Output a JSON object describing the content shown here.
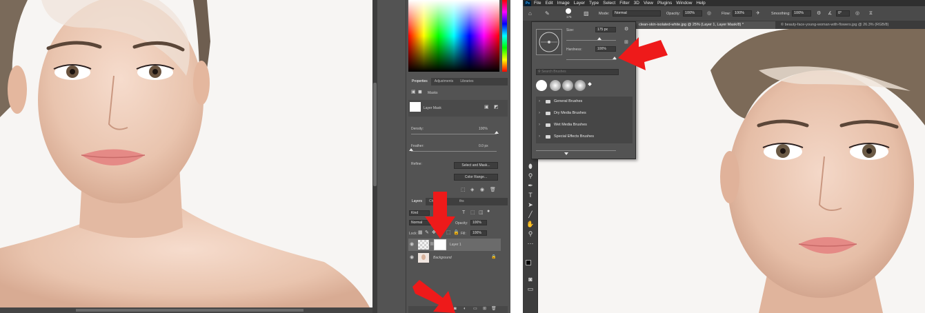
{
  "colors": {
    "arrow": "#f01a1a",
    "panel_bg": "#535353",
    "dark_bg": "#2f2f2f",
    "canvas_bg": "#ffffff"
  },
  "left": {
    "properties_tabs": [
      "Properties",
      "Adjustments",
      "Libraries"
    ],
    "masks_label": "Masks",
    "layer_mask_label": "Layer Mask",
    "density_label": "Density:",
    "density_value": "100%",
    "feather_label": "Feather:",
    "feather_value": "0.0 px",
    "refine_label": "Refine:",
    "select_mask_button": "Select and Mask...",
    "color_range_button": "Color Range...",
    "layers_tabs": [
      "Layers",
      "Chan",
      "ths"
    ],
    "kind_label": "Kind",
    "blend_mode": "Normal",
    "opacity_label": "Opacity:",
    "opacity_value": "100%",
    "lock_label": "Lock:",
    "fill_label": "Fill:",
    "fill_value": "100%",
    "layers": [
      {
        "name": "Layer 1",
        "selected": true
      },
      {
        "name": "Background",
        "selected": false
      }
    ],
    "footer_fx": "fx"
  },
  "right": {
    "menu": [
      "File",
      "Edit",
      "Image",
      "Layer",
      "Type",
      "Select",
      "Filter",
      "3D",
      "View",
      "Plugins",
      "Window",
      "Help"
    ],
    "ps_logo": "Ps",
    "options": {
      "brush_size": "175",
      "mode_label": "Mode:",
      "mode_value": "Normal",
      "opacity_label": "Opacity:",
      "opacity_value": "100%",
      "flow_label": "Flow:",
      "flow_value": "100%",
      "smoothing_label": "Smoothing:",
      "smoothing_value": "100%",
      "angle_value": "0°"
    },
    "doc_tabs": [
      {
        "label": "clean-skin-isolated-white.jpg @ 25% (Layer 1, Layer Mask/8) *",
        "active": true
      },
      {
        "label": "© beauty-face-young-woman-with-flowers.jpg @ 26.3% (RGB/8)",
        "active": false
      }
    ],
    "brush_popup": {
      "size_label": "Size:",
      "size_value": "175 px",
      "hardness_label": "Hardness:",
      "hardness_value": "100%",
      "search_placeholder": "Search Brushes",
      "folders": [
        "General Brushes",
        "Dry Media Brushes",
        "Wet Media Brushes",
        "Special Effects Brushes"
      ]
    }
  }
}
